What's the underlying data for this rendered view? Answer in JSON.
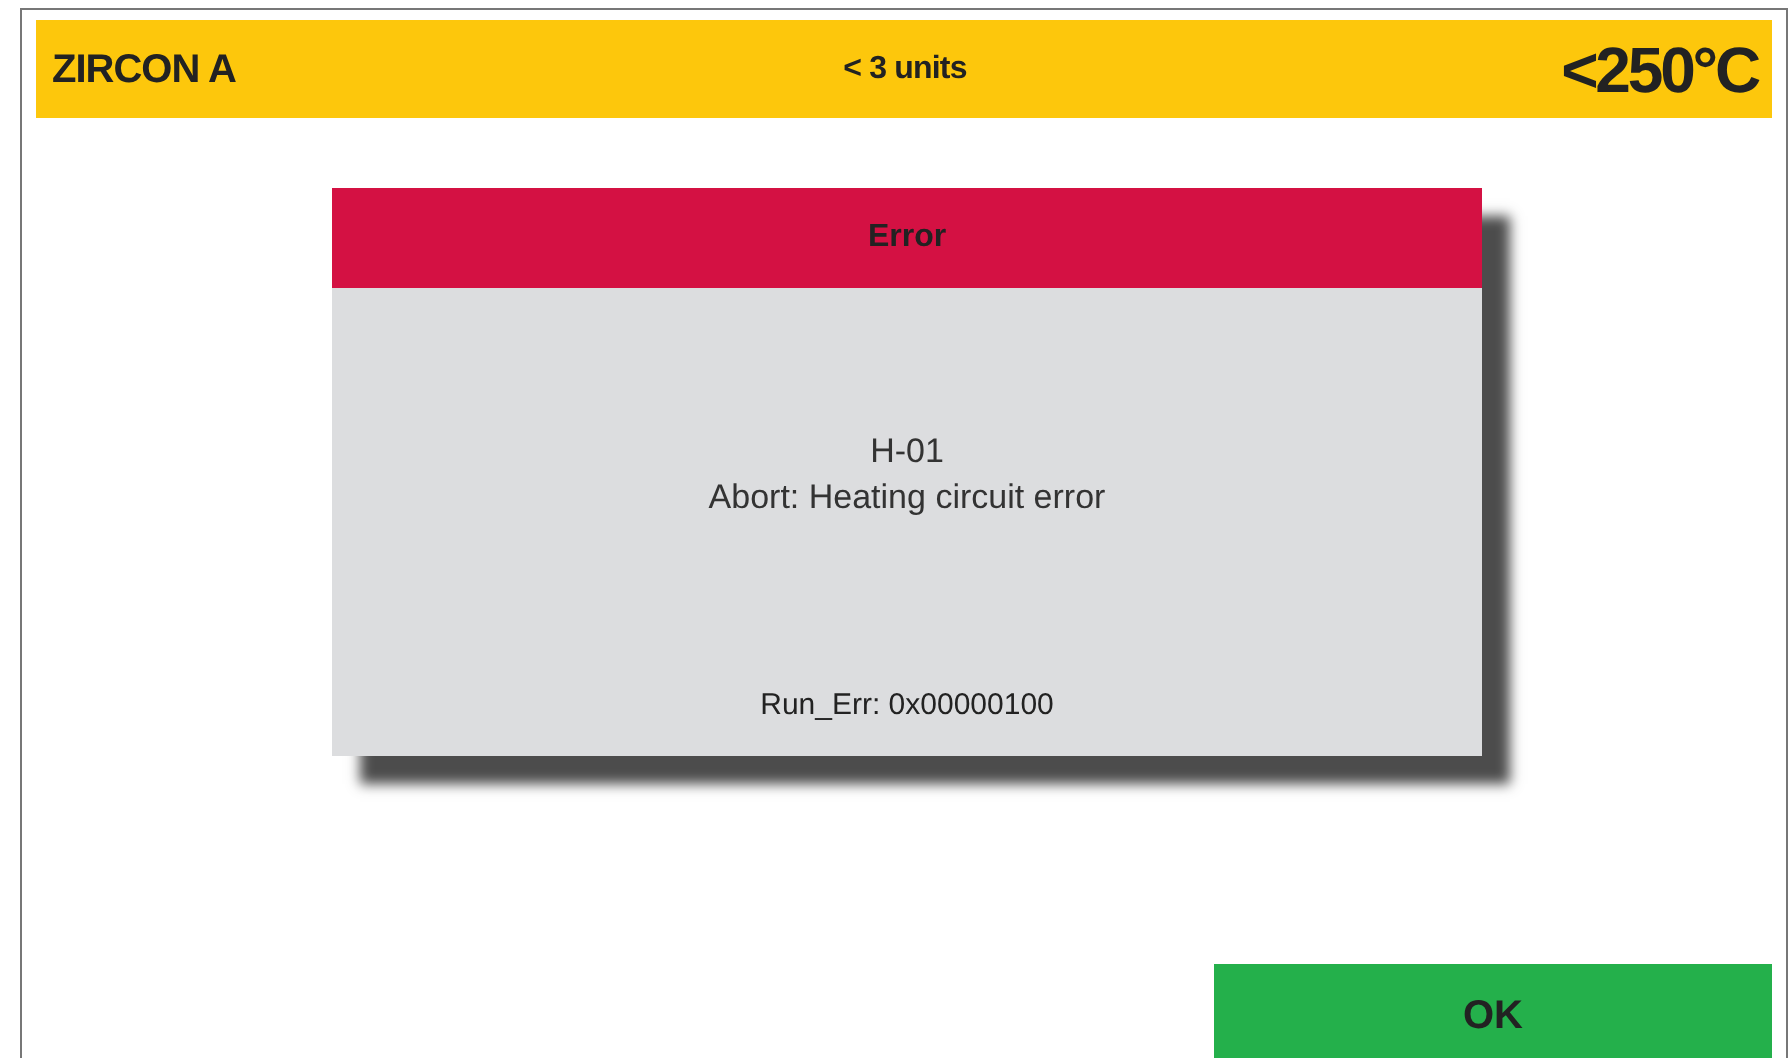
{
  "header": {
    "title": "ZIRCON A",
    "units": "< 3 units",
    "temperature": "<250°C"
  },
  "dialog": {
    "title": "Error",
    "code": "H-01",
    "message": "Abort: Heating circuit error",
    "detail": "Run_Err: 0x00000100"
  },
  "buttons": [
    "OK"
  ]
}
